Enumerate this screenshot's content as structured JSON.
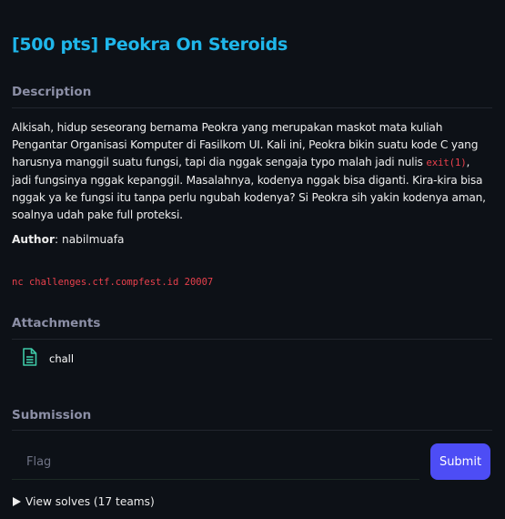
{
  "challenge": {
    "title": "[500 pts] Peokra On Steroids"
  },
  "description": {
    "heading": "Description",
    "para_part1": "Alkisah, hidup seseorang bernama Peokra yang merupakan maskot mata kuliah Pengantar Organisasi Komputer di Fasilkom UI. Kali ini, Peokra bikin suatu kode C yang harusnya manggil suatu fungsi, tapi dia nggak sengaja typo malah jadi nulis ",
    "para_code": "exit(1)",
    "para_part2": ", jadi fungsinya nggak kepanggil. Masalahnya, kodenya nggak bisa diganti. Kira-kira bisa nggak ya ke fungsi itu tanpa perlu ngubah kodenya? Si Peokra sih yakin kodenya aman, soalnya udah pake full proteksi.",
    "author_label": "Author",
    "author_value": ": nabilmuafa",
    "connection": "nc challenges.ctf.compfest.id 20007"
  },
  "attachments": {
    "heading": "Attachments",
    "files": [
      {
        "name": "chall",
        "icon": "file-icon"
      }
    ]
  },
  "submission": {
    "heading": "Submission",
    "placeholder": "Flag",
    "submit_label": "Submit",
    "solves_label": "View solves (17 teams)"
  },
  "colors": {
    "background": "#0d1117",
    "title": "#1fb6ea",
    "heading": "#8c8fa6",
    "code": "#e8404c",
    "button": "#4d4df5",
    "icon": "#3ec9a7"
  }
}
